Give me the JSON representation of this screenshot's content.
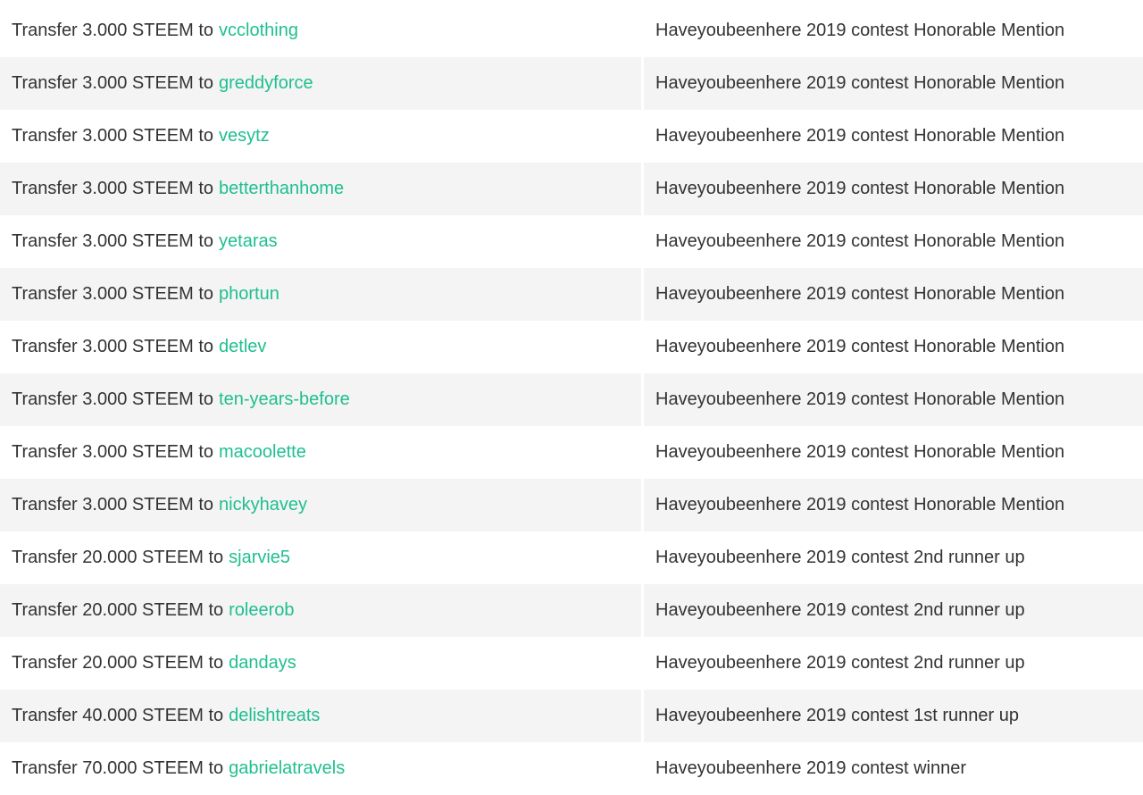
{
  "transfers": [
    {
      "memo_prefix": "Transfer 3.000 STEEM to",
      "recipient": "vcclothing",
      "memo": "Haveyoubeenhere 2019 contest Honorable Mention"
    },
    {
      "memo_prefix": "Transfer 3.000 STEEM to",
      "recipient": "greddyforce",
      "memo": "Haveyoubeenhere 2019 contest Honorable Mention"
    },
    {
      "memo_prefix": "Transfer 3.000 STEEM to",
      "recipient": "vesytz",
      "memo": "Haveyoubeenhere 2019 contest Honorable Mention"
    },
    {
      "memo_prefix": "Transfer 3.000 STEEM to",
      "recipient": "betterthanhome",
      "memo": "Haveyoubeenhere 2019 contest Honorable Mention"
    },
    {
      "memo_prefix": "Transfer 3.000 STEEM to",
      "recipient": "yetaras",
      "memo": "Haveyoubeenhere 2019 contest Honorable Mention"
    },
    {
      "memo_prefix": "Transfer 3.000 STEEM to",
      "recipient": "phortun",
      "memo": "Haveyoubeenhere 2019 contest Honorable Mention"
    },
    {
      "memo_prefix": "Transfer 3.000 STEEM to",
      "recipient": "detlev",
      "memo": "Haveyoubeenhere 2019 contest Honorable Mention"
    },
    {
      "memo_prefix": "Transfer 3.000 STEEM to",
      "recipient": "ten-years-before",
      "memo": "Haveyoubeenhere 2019 contest Honorable Mention"
    },
    {
      "memo_prefix": "Transfer 3.000 STEEM to",
      "recipient": "macoolette",
      "memo": "Haveyoubeenhere 2019 contest Honorable Mention"
    },
    {
      "memo_prefix": "Transfer 3.000 STEEM to",
      "recipient": "nickyhavey",
      "memo": "Haveyoubeenhere 2019 contest Honorable Mention"
    },
    {
      "memo_prefix": "Transfer 20.000 STEEM to",
      "recipient": "sjarvie5",
      "memo": "Haveyoubeenhere 2019 contest 2nd runner up"
    },
    {
      "memo_prefix": "Transfer 20.000 STEEM to",
      "recipient": "roleerob",
      "memo": "Haveyoubeenhere 2019 contest 2nd runner up"
    },
    {
      "memo_prefix": "Transfer 20.000 STEEM to",
      "recipient": "dandays",
      "memo": "Haveyoubeenhere 2019 contest 2nd runner up"
    },
    {
      "memo_prefix": "Transfer 40.000 STEEM to",
      "recipient": "delishtreats",
      "memo": "Haveyoubeenhere 2019 contest 1st runner up"
    },
    {
      "memo_prefix": "Transfer 70.000 STEEM to",
      "recipient": "gabrielatravels",
      "memo": "Haveyoubeenhere 2019 contest winner"
    }
  ],
  "colors": {
    "link": "#1fbf8f",
    "text": "#333333",
    "row_alt": "#f4f4f4"
  }
}
